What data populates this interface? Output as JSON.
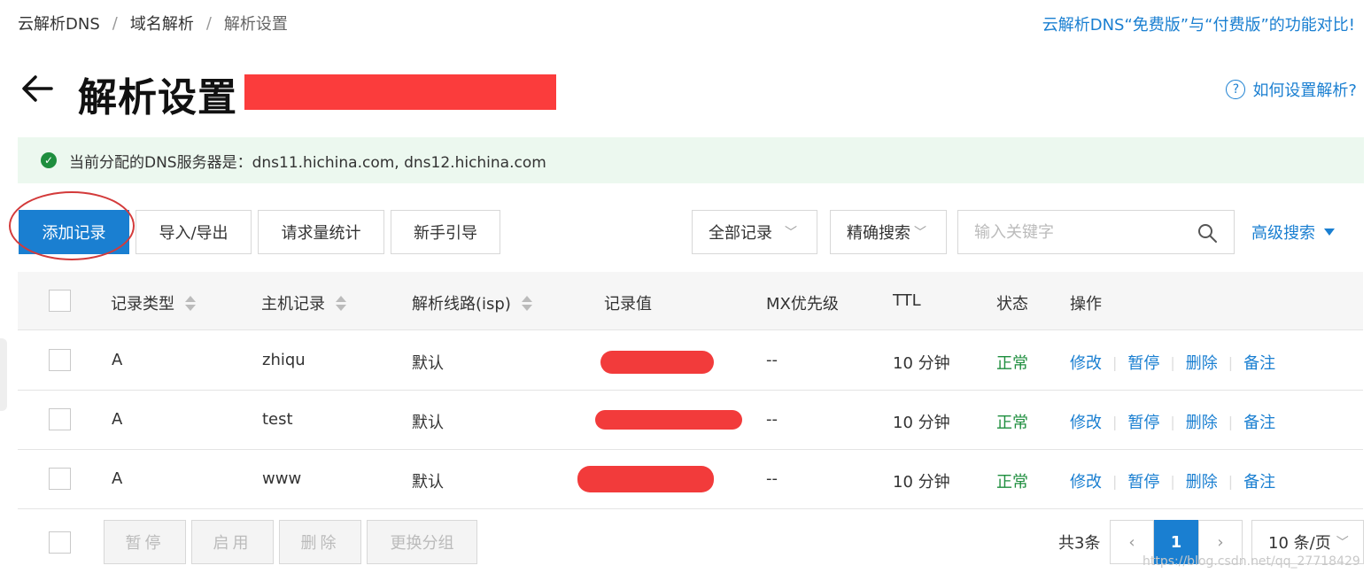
{
  "breadcrumb": {
    "item1": "云解析DNS",
    "sep": "/",
    "item2": "域名解析",
    "item3": "解析设置"
  },
  "compare_link": "云解析DNS“免费版”与“付费版”的功能对比!",
  "title": "解析设置",
  "help_link": "如何设置解析?",
  "help_icon_glyph": "?",
  "alert": {
    "icon": "check-circle-icon",
    "text": "当前分配的DNS服务器是：dns11.hichina.com, dns12.hichina.com"
  },
  "toolbar": {
    "add_record": "添加记录",
    "import_export": "导入/导出",
    "request_stats": "请求量统计",
    "guide": "新手引导",
    "filter_all": "全部记录",
    "filter_exact": "精确搜索",
    "search_placeholder": "输入关键字",
    "advanced_search": "高级搜索"
  },
  "table": {
    "headers": {
      "type": "记录类型",
      "host": "主机记录",
      "line": "解析线路(isp)",
      "value": "记录值",
      "mx": "MX优先级",
      "ttl": "TTL",
      "status": "状态",
      "ops": "操作"
    },
    "rows": [
      {
        "type": "A",
        "host": "zhiqu",
        "line": "默认",
        "mx": "--",
        "ttl": "10 分钟",
        "status": "正常"
      },
      {
        "type": "A",
        "host": "test",
        "line": "默认",
        "mx": "--",
        "ttl": "10 分钟",
        "status": "正常"
      },
      {
        "type": "A",
        "host": "www",
        "line": "默认",
        "mx": "--",
        "ttl": "10 分钟",
        "status": "正常"
      }
    ],
    "actions": {
      "edit": "修改",
      "pause": "暂停",
      "delete": "删除",
      "note": "备注"
    }
  },
  "footer": {
    "pause": "暂停",
    "enable": "启用",
    "delete": "删除",
    "change_group": "更换分组",
    "total": "共3条",
    "current_page": "1",
    "page_size": "10 条/页",
    "prev": "‹",
    "next": "›"
  },
  "watermark": "https://blog.csdn.net/qq_27718429",
  "colors": {
    "primary": "#1a7fd1",
    "success": "#1e8e3e",
    "alert_bg": "#ecf8ef",
    "redaction": "#fb3c3c"
  }
}
